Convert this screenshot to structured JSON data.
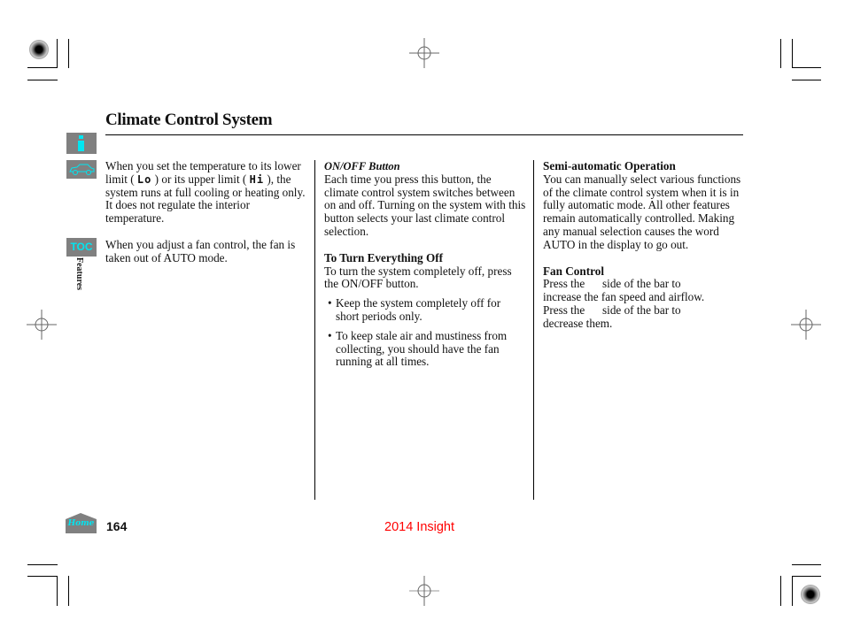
{
  "page": {
    "title": "Climate Control System",
    "section_tab": "Features",
    "page_number": "164",
    "model_label": "2014 Insight",
    "accent_color": "#00e5f0",
    "model_label_color": "#ff0000",
    "icon_bg_color": "#808080"
  },
  "nav_icons": {
    "info": "i",
    "toc": "TOC",
    "home": "Home"
  },
  "columns": {
    "left": {
      "para1": {
        "t1": "When you set the temperature to its lower limit (",
        "lcd_lo": "Lo",
        "t2": ") or its upper limit (",
        "lcd_hi": "Hi",
        "t3": "), the system runs at full cooling or heating only. It does not regulate the interior temperature."
      },
      "para2": "When you adjust a fan control, the fan is taken out of AUTO mode."
    },
    "middle": {
      "onoff_heading": "ON/OFF Button",
      "onoff_body": "Each time you press this button, the climate control system switches between on and off. Turning on the system with this button selects your last climate control selection.",
      "off_heading": "To Turn Everything Off",
      "off_body": "To turn the system completely off, press the ON/OFF button.",
      "bullets": [
        "Keep the system completely off for short periods only.",
        "To keep stale air and mustiness from collecting, you should have the fan running at all times."
      ]
    },
    "right": {
      "semi_heading": "Semi-automatic Operation",
      "semi_body": "You can manually select various functions of the climate control system when it is in fully automatic mode. All other features remain automatically controlled. Making any manual selection causes the word AUTO in the display to go out.",
      "fan_heading": "Fan Control",
      "fan_lines": [
        "Press the      side of the bar to",
        "increase the fan speed and airflow.",
        "Press the      side of the bar to",
        "decrease them."
      ]
    }
  }
}
